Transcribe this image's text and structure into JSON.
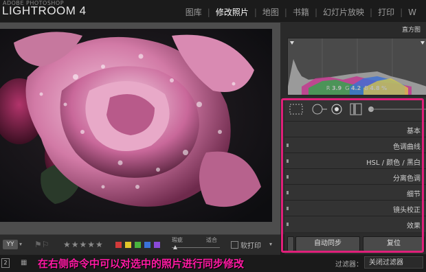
{
  "app": {
    "brand_small": "ADOBE PHOTOSHOP",
    "brand": "LIGHTROOM 4"
  },
  "modules": [
    {
      "label": "图库",
      "active": false
    },
    {
      "label": "修改照片",
      "active": true
    },
    {
      "label": "地图",
      "active": false
    },
    {
      "label": "书籍",
      "active": false
    },
    {
      "label": "幻灯片放映",
      "active": false
    },
    {
      "label": "打印",
      "active": false
    },
    {
      "label": "W",
      "active": false
    }
  ],
  "histogram": {
    "title": "直方图",
    "r_label": "R",
    "r_value": "3.9",
    "g_label": "G",
    "g_value": "4.2",
    "b_label": "B",
    "b_value": "4.8",
    "pct": "%"
  },
  "panels": [
    {
      "label": "基本"
    },
    {
      "label": "色调曲线"
    },
    {
      "label": "HSL / 颜色 / 黑白"
    },
    {
      "label": "分离色调"
    },
    {
      "label": "细节"
    },
    {
      "label": "镜头校正"
    },
    {
      "label": "效果"
    }
  ],
  "buttons": {
    "sync": "自动同步",
    "reset": "复位"
  },
  "toolbar": {
    "flag_label": "旗标",
    "stars": "★★★★★",
    "label_colors": [
      "#d23a3a",
      "#e0c52a",
      "#49b33e",
      "#3a72d8",
      "#8a4ad8"
    ],
    "slider_left": "瑕疵",
    "slider_right": "适合",
    "soft_proof": "软打印"
  },
  "filmstrip": {
    "page": "2",
    "filter_label": "过滤器：",
    "filter_value": "关闭过滤器"
  },
  "caption": "在右侧命令中可以对选中的照片进行同步修改"
}
